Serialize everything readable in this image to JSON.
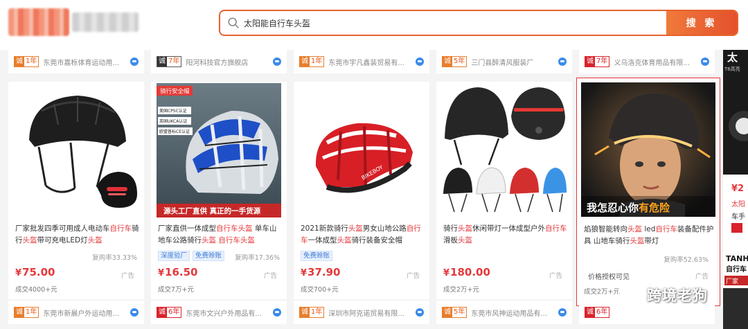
{
  "header": {
    "search_value": "太阳能自行车头盔",
    "search_button": "搜 索"
  },
  "top_suppliers": [
    {
      "years": "1年",
      "name": "东莞市嘉栎体育运动用...",
      "badge": "orange"
    },
    {
      "years": "7年",
      "name": "阳河科技官方旗舰店",
      "badge": "dark"
    },
    {
      "years": "1年",
      "name": "东莞市宇凡鑫装贸易有...",
      "badge": "orange"
    },
    {
      "years": "5年",
      "name": "三门县醉清风服装厂",
      "badge": "orange"
    },
    {
      "years": "7年",
      "name": "义乌洛克体育用品有限...",
      "badge": "red"
    }
  ],
  "badge_char": "诚",
  "products": [
    {
      "title_parts": [
        "厂家批发四季可用成人电动车",
        "自行车",
        "骑行",
        "头盔",
        "带可充电LED灯",
        "头盔",
        ""
      ],
      "tags": [],
      "repurchase": "复购率33.33%",
      "price": "75.00",
      "ad": "广告",
      "deal": "成交4000+元"
    },
    {
      "title_parts": [
        "厂家直供一体成型",
        "自行车头盔",
        " 单车山地车公路骑行",
        "头盔",
        " ",
        "自行车头盔",
        ""
      ],
      "tags": [
        "深度验厂",
        "免费赊账"
      ],
      "repurchase": "复购率17.36%",
      "price": "16.50",
      "ad": "广告",
      "deal": "成交7万+元",
      "image_text": {
        "top": "骑行安全帽",
        "certs": [
          "美国CPSC认证",
          "英国UKCA认证",
          "欧盟普标CE认证"
        ],
        "banner": "源头工厂直供 真正的一手货源"
      }
    },
    {
      "title_parts": [
        "2021新款骑行",
        "头盔",
        "男女山地公路",
        "自行车",
        "一体成型",
        "头盔",
        "骑行装备安全帽"
      ],
      "tags": [
        "免费赊账"
      ],
      "repurchase": "",
      "price": "37.90",
      "ad": "广告",
      "deal": "成交700+元"
    },
    {
      "title_parts": [
        "骑行",
        "头盔",
        "休闲带灯一体成型户外",
        "自行车",
        "滑板",
        "头盔",
        ""
      ],
      "tags": [],
      "repurchase": "",
      "price": "180.00",
      "ad": "广告",
      "deal": "成交2万+元"
    },
    {
      "title_parts": [
        "焰狼智能转向",
        "头盔",
        " led",
        "自行车",
        "装备配件护具 山地车骑行",
        "头盔",
        "带灯"
      ],
      "tags": [],
      "repurchase": "复购率52.63%",
      "price_auth": "价格授权可见",
      "ad": "广告",
      "deal": "成交2万+元",
      "image_text": {
        "banner_white": "我怎忍心你",
        "banner_orange": "有危险"
      }
    }
  ],
  "bottom_suppliers": [
    {
      "years": "1年",
      "name": "东莞市新晨户外运动用...",
      "badge": "orange"
    },
    {
      "years": "6年",
      "name": "东莞市文兴户外用品有...",
      "badge": "red"
    },
    {
      "years": "1年",
      "name": "深圳市阿克诺贸易有限...",
      "badge": "orange"
    },
    {
      "years": "5年",
      "name": "东莞市风神运动用品有...",
      "badge": "orange"
    },
    {
      "years": "6年",
      "name": "",
      "badge": "red"
    }
  ],
  "partial_column": {
    "img_text": "太",
    "img_sub": "T6高亮",
    "price_fragment": "¥2",
    "red_text": "太阳",
    "desc": "车手",
    "tanh": "TANH",
    "tanh_sub": "自行车",
    "tanh_red": "厂家"
  },
  "watermark": "跨境老狗"
}
